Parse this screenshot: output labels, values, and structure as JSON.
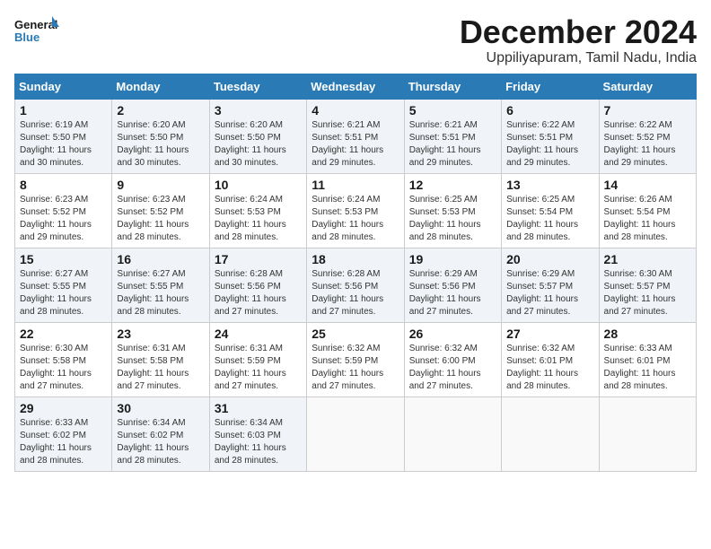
{
  "logo": {
    "line1": "General",
    "line2": "Blue"
  },
  "title": "December 2024",
  "subtitle": "Uppiliyapuram, Tamil Nadu, India",
  "headers": [
    "Sunday",
    "Monday",
    "Tuesday",
    "Wednesday",
    "Thursday",
    "Friday",
    "Saturday"
  ],
  "weeks": [
    [
      {
        "day": "1",
        "info": "Sunrise: 6:19 AM\nSunset: 5:50 PM\nDaylight: 11 hours\nand 30 minutes."
      },
      {
        "day": "2",
        "info": "Sunrise: 6:20 AM\nSunset: 5:50 PM\nDaylight: 11 hours\nand 30 minutes."
      },
      {
        "day": "3",
        "info": "Sunrise: 6:20 AM\nSunset: 5:50 PM\nDaylight: 11 hours\nand 30 minutes."
      },
      {
        "day": "4",
        "info": "Sunrise: 6:21 AM\nSunset: 5:51 PM\nDaylight: 11 hours\nand 29 minutes."
      },
      {
        "day": "5",
        "info": "Sunrise: 6:21 AM\nSunset: 5:51 PM\nDaylight: 11 hours\nand 29 minutes."
      },
      {
        "day": "6",
        "info": "Sunrise: 6:22 AM\nSunset: 5:51 PM\nDaylight: 11 hours\nand 29 minutes."
      },
      {
        "day": "7",
        "info": "Sunrise: 6:22 AM\nSunset: 5:52 PM\nDaylight: 11 hours\nand 29 minutes."
      }
    ],
    [
      {
        "day": "8",
        "info": "Sunrise: 6:23 AM\nSunset: 5:52 PM\nDaylight: 11 hours\nand 29 minutes."
      },
      {
        "day": "9",
        "info": "Sunrise: 6:23 AM\nSunset: 5:52 PM\nDaylight: 11 hours\nand 28 minutes."
      },
      {
        "day": "10",
        "info": "Sunrise: 6:24 AM\nSunset: 5:53 PM\nDaylight: 11 hours\nand 28 minutes."
      },
      {
        "day": "11",
        "info": "Sunrise: 6:24 AM\nSunset: 5:53 PM\nDaylight: 11 hours\nand 28 minutes."
      },
      {
        "day": "12",
        "info": "Sunrise: 6:25 AM\nSunset: 5:53 PM\nDaylight: 11 hours\nand 28 minutes."
      },
      {
        "day": "13",
        "info": "Sunrise: 6:25 AM\nSunset: 5:54 PM\nDaylight: 11 hours\nand 28 minutes."
      },
      {
        "day": "14",
        "info": "Sunrise: 6:26 AM\nSunset: 5:54 PM\nDaylight: 11 hours\nand 28 minutes."
      }
    ],
    [
      {
        "day": "15",
        "info": "Sunrise: 6:27 AM\nSunset: 5:55 PM\nDaylight: 11 hours\nand 28 minutes."
      },
      {
        "day": "16",
        "info": "Sunrise: 6:27 AM\nSunset: 5:55 PM\nDaylight: 11 hours\nand 28 minutes."
      },
      {
        "day": "17",
        "info": "Sunrise: 6:28 AM\nSunset: 5:56 PM\nDaylight: 11 hours\nand 27 minutes."
      },
      {
        "day": "18",
        "info": "Sunrise: 6:28 AM\nSunset: 5:56 PM\nDaylight: 11 hours\nand 27 minutes."
      },
      {
        "day": "19",
        "info": "Sunrise: 6:29 AM\nSunset: 5:56 PM\nDaylight: 11 hours\nand 27 minutes."
      },
      {
        "day": "20",
        "info": "Sunrise: 6:29 AM\nSunset: 5:57 PM\nDaylight: 11 hours\nand 27 minutes."
      },
      {
        "day": "21",
        "info": "Sunrise: 6:30 AM\nSunset: 5:57 PM\nDaylight: 11 hours\nand 27 minutes."
      }
    ],
    [
      {
        "day": "22",
        "info": "Sunrise: 6:30 AM\nSunset: 5:58 PM\nDaylight: 11 hours\nand 27 minutes."
      },
      {
        "day": "23",
        "info": "Sunrise: 6:31 AM\nSunset: 5:58 PM\nDaylight: 11 hours\nand 27 minutes."
      },
      {
        "day": "24",
        "info": "Sunrise: 6:31 AM\nSunset: 5:59 PM\nDaylight: 11 hours\nand 27 minutes."
      },
      {
        "day": "25",
        "info": "Sunrise: 6:32 AM\nSunset: 5:59 PM\nDaylight: 11 hours\nand 27 minutes."
      },
      {
        "day": "26",
        "info": "Sunrise: 6:32 AM\nSunset: 6:00 PM\nDaylight: 11 hours\nand 27 minutes."
      },
      {
        "day": "27",
        "info": "Sunrise: 6:32 AM\nSunset: 6:01 PM\nDaylight: 11 hours\nand 28 minutes."
      },
      {
        "day": "28",
        "info": "Sunrise: 6:33 AM\nSunset: 6:01 PM\nDaylight: 11 hours\nand 28 minutes."
      }
    ],
    [
      {
        "day": "29",
        "info": "Sunrise: 6:33 AM\nSunset: 6:02 PM\nDaylight: 11 hours\nand 28 minutes."
      },
      {
        "day": "30",
        "info": "Sunrise: 6:34 AM\nSunset: 6:02 PM\nDaylight: 11 hours\nand 28 minutes."
      },
      {
        "day": "31",
        "info": "Sunrise: 6:34 AM\nSunset: 6:03 PM\nDaylight: 11 hours\nand 28 minutes."
      },
      {
        "day": "",
        "info": ""
      },
      {
        "day": "",
        "info": ""
      },
      {
        "day": "",
        "info": ""
      },
      {
        "day": "",
        "info": ""
      }
    ]
  ]
}
